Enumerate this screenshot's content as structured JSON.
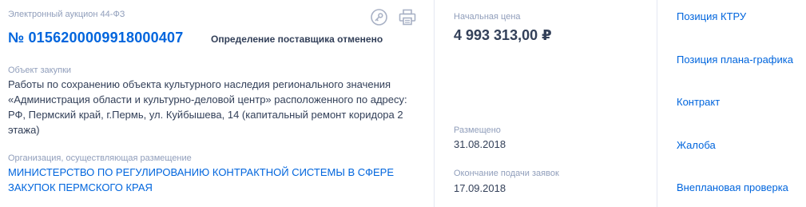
{
  "header": {
    "procurement_type": "Электронный аукцион 44-ФЗ",
    "registry_number": "№ 0156200009918000407",
    "status": "Определение поставщика отменено"
  },
  "object": {
    "label": "Объект закупки",
    "description": "Работы по сохранению объекта культурного наследия регионального значения «Администрация области и культурно-деловой центр» расположенного по адресу: РФ, Пермский край, г.Пермь, ул. Куйбышева, 14 (капитальный ремонт коридора 2 этажа)"
  },
  "organization": {
    "label": "Организация, осуществляющая размещение",
    "name": "МИНИСТЕРСТВО ПО РЕГУЛИРОВАНИЮ КОНТРАКТНОЙ СИСТЕМЫ В СФЕРЕ ЗАКУПОК ПЕРМСКОГО КРАЯ"
  },
  "pricing": {
    "initial_price_label": "Начальная цена",
    "initial_price": "4 993 313,00 ₽",
    "posted_label": "Размещено",
    "posted_date": "31.08.2018",
    "deadline_label": "Окончание подачи заявок",
    "deadline_date": "17.09.2018"
  },
  "links": [
    "Позиция КТРУ",
    "Позиция плана-графика",
    "Контракт",
    "Жалоба",
    "Внеплановая проверка"
  ],
  "icons": {
    "key": "key-icon",
    "print": "print-icon"
  },
  "colors": {
    "link": "#0065dd",
    "text": "#334059",
    "muted": "#909ebb",
    "icon": "#a8b1c5"
  }
}
